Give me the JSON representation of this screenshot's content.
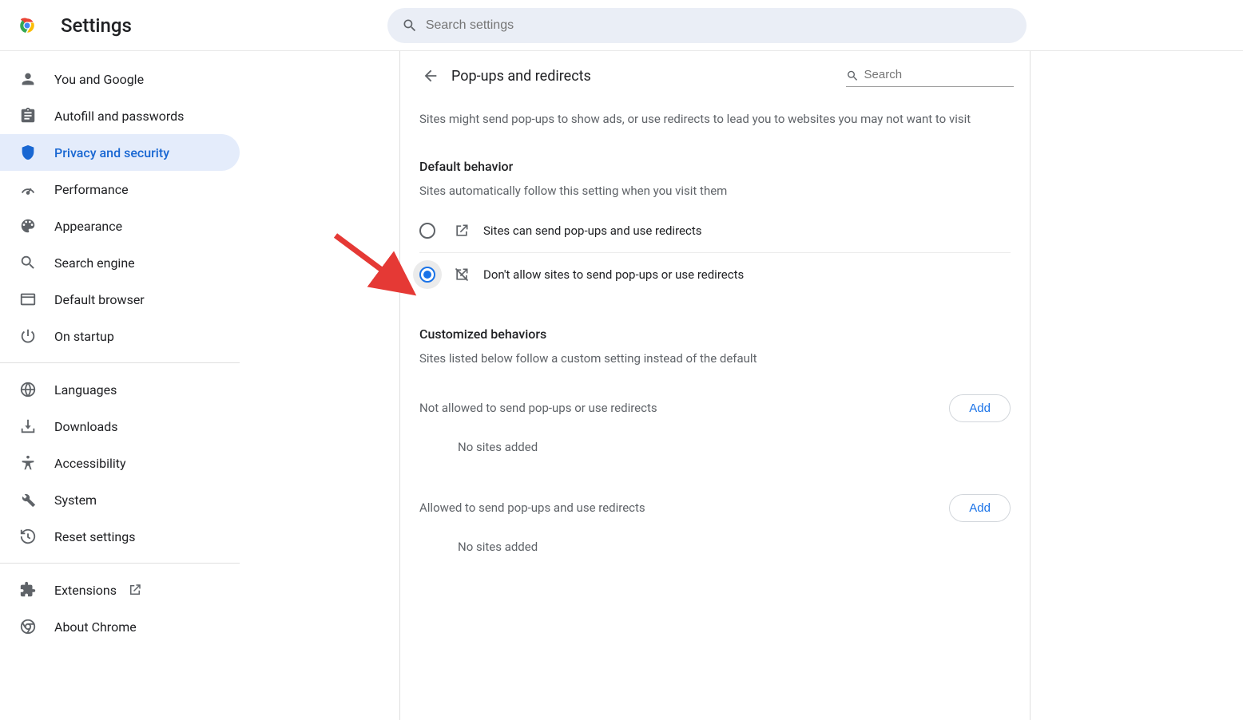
{
  "header": {
    "title": "Settings",
    "search_placeholder": "Search settings"
  },
  "sidebar": {
    "items": [
      {
        "label": "You and Google"
      },
      {
        "label": "Autofill and passwords"
      },
      {
        "label": "Privacy and security"
      },
      {
        "label": "Performance"
      },
      {
        "label": "Appearance"
      },
      {
        "label": "Search engine"
      },
      {
        "label": "Default browser"
      },
      {
        "label": "On startup"
      },
      {
        "label": "Languages"
      },
      {
        "label": "Downloads"
      },
      {
        "label": "Accessibility"
      },
      {
        "label": "System"
      },
      {
        "label": "Reset settings"
      },
      {
        "label": "Extensions"
      },
      {
        "label": "About Chrome"
      }
    ]
  },
  "panel": {
    "title": "Pop-ups and redirects",
    "search_placeholder": "Search",
    "desc": "Sites might send pop-ups to show ads, or use redirects to lead you to websites you may not want to visit",
    "default_behavior_title": "Default behavior",
    "default_behavior_sub": "Sites automatically follow this setting when you visit them",
    "radio_allow": "Sites can send pop-ups and use redirects",
    "radio_block": "Don't allow sites to send pop-ups or use redirects",
    "custom_title": "Customized behaviors",
    "custom_sub": "Sites listed below follow a custom setting instead of the default",
    "not_allowed_title": "Not allowed to send pop-ups or use redirects",
    "allowed_title": "Allowed to send pop-ups and use redirects",
    "no_sites": "No sites added",
    "add_label": "Add"
  }
}
